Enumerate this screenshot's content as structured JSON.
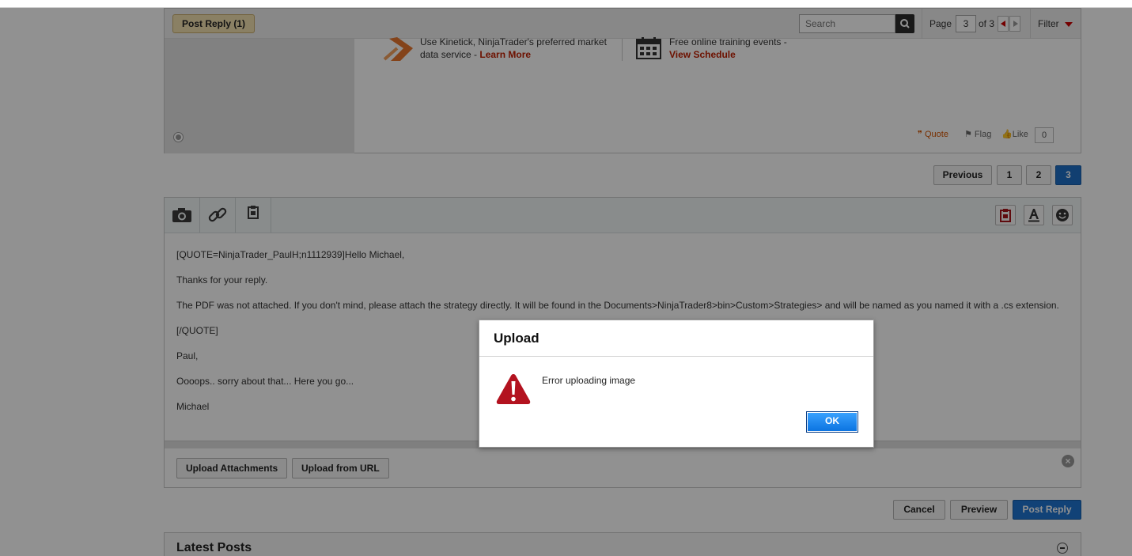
{
  "post_toolbar": {
    "post_reply_label": "Post Reply (1)",
    "search_placeholder": "Search",
    "page_label": "Page",
    "page_current": "3",
    "page_of": "of 3",
    "filter_label": "Filter"
  },
  "post": {
    "ad1_text": "Use Kinetick, NinjaTrader's preferred market data service - ",
    "ad1_link": "Learn More",
    "ad2_text": "Free online training events - ",
    "ad2_link": "View Schedule",
    "actions": {
      "quote": "Quote",
      "flag": "Flag",
      "like": "Like",
      "like_count": "0"
    }
  },
  "pagination": {
    "previous": "Previous",
    "pages": [
      "1",
      "2",
      "3"
    ]
  },
  "editor": {
    "lines": [
      "[QUOTE=NinjaTrader_PaulH;n1112939]Hello Michael,",
      "Thanks for your reply.",
      "The PDF was not attached. If you don't mind, please attach the strategy directly. It will be found in the Documents>NinjaTrader8>bin>Custom>Strategies> and will be named as you named it with a .cs extension.",
      "[/QUOTE]",
      "Paul,",
      "Oooops.. sorry about that... Here you go...",
      "Michael"
    ],
    "upload_attachments": "Upload Attachments",
    "upload_from_url": "Upload from URL"
  },
  "actions": {
    "cancel": "Cancel",
    "preview": "Preview",
    "post_reply": "Post Reply"
  },
  "latest_posts": {
    "title": "Latest Posts"
  },
  "dialog": {
    "title": "Upload",
    "message": "Error uploading image",
    "ok": "OK"
  },
  "colors": {
    "accent_blue": "#1e6fc7",
    "link_red": "#c01f00",
    "quote_orange": "#d35400",
    "error_red": "#b3121f"
  }
}
